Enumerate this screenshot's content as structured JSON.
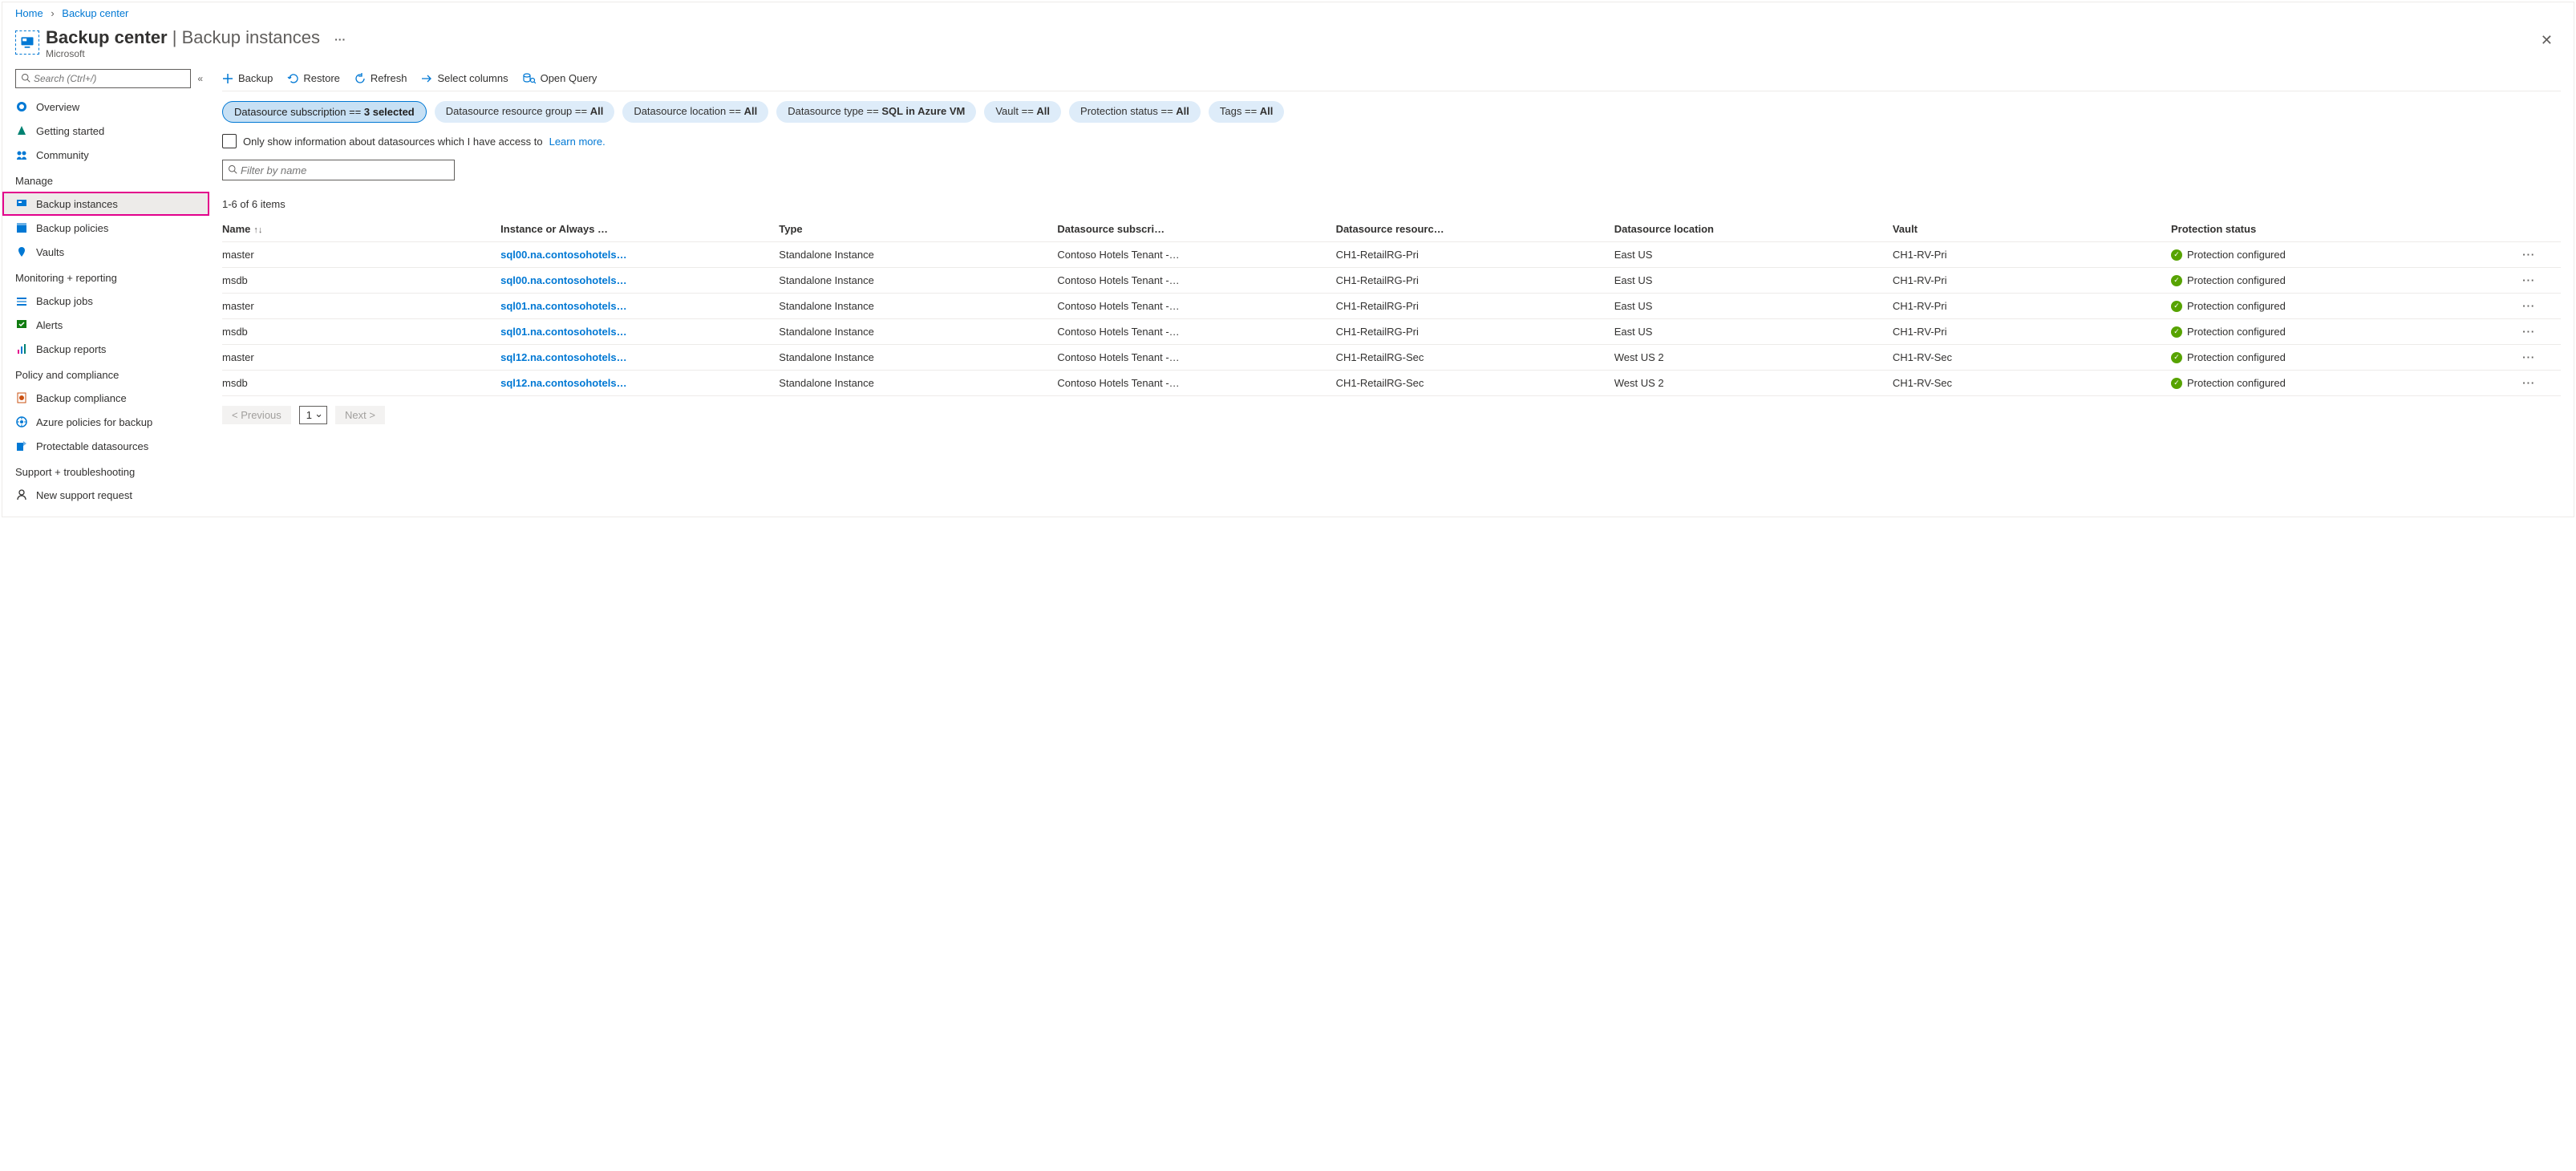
{
  "breadcrumb": {
    "home": "Home",
    "current": "Backup center"
  },
  "header": {
    "title_strong": "Backup center",
    "title_rest": "Backup instances",
    "subtitle": "Microsoft",
    "more": "···"
  },
  "sidebar": {
    "search_placeholder": "Search (Ctrl+/)",
    "top_items": [
      {
        "label": "Overview"
      },
      {
        "label": "Getting started"
      },
      {
        "label": "Community"
      }
    ],
    "groups": [
      {
        "label": "Manage",
        "items": [
          {
            "label": "Backup instances",
            "active": true
          },
          {
            "label": "Backup policies"
          },
          {
            "label": "Vaults"
          }
        ]
      },
      {
        "label": "Monitoring + reporting",
        "items": [
          {
            "label": "Backup jobs"
          },
          {
            "label": "Alerts"
          },
          {
            "label": "Backup reports"
          }
        ]
      },
      {
        "label": "Policy and compliance",
        "items": [
          {
            "label": "Backup compliance"
          },
          {
            "label": "Azure policies for backup"
          },
          {
            "label": "Protectable datasources"
          }
        ]
      },
      {
        "label": "Support + troubleshooting",
        "items": [
          {
            "label": "New support request"
          }
        ]
      }
    ]
  },
  "toolbar": {
    "backup": "Backup",
    "restore": "Restore",
    "refresh": "Refresh",
    "select_columns": "Select columns",
    "open_query": "Open Query"
  },
  "filters": [
    {
      "label": "Datasource subscription == ",
      "value": "3 selected",
      "selected": true
    },
    {
      "label": "Datasource resource group == ",
      "value": "All"
    },
    {
      "label": "Datasource location == ",
      "value": "All"
    },
    {
      "label": "Datasource type == ",
      "value": "SQL in Azure VM"
    },
    {
      "label": "Vault == ",
      "value": "All"
    },
    {
      "label": "Protection status == ",
      "value": "All"
    },
    {
      "label": "Tags == ",
      "value": "All"
    }
  ],
  "access_checkbox": {
    "text": "Only show information about datasources which I have access to ",
    "link": "Learn more."
  },
  "filter_input_placeholder": "Filter by name",
  "count_label": "1-6 of 6 items",
  "columns": [
    "Name",
    "Instance or Always …",
    "Type",
    "Datasource subscri…",
    "Datasource resourc…",
    "Datasource location",
    "Vault",
    "Protection status"
  ],
  "rows": [
    {
      "name": "master",
      "instance": "sql00.na.contosohotels…",
      "type": "Standalone Instance",
      "sub": "Contoso Hotels Tenant -…",
      "rg": "CH1-RetailRG-Pri",
      "loc": "East US",
      "vault": "CH1-RV-Pri",
      "status": "Protection configured"
    },
    {
      "name": "msdb",
      "instance": "sql00.na.contosohotels…",
      "type": "Standalone Instance",
      "sub": "Contoso Hotels Tenant -…",
      "rg": "CH1-RetailRG-Pri",
      "loc": "East US",
      "vault": "CH1-RV-Pri",
      "status": "Protection configured"
    },
    {
      "name": "master",
      "instance": "sql01.na.contosohotels…",
      "type": "Standalone Instance",
      "sub": "Contoso Hotels Tenant -…",
      "rg": "CH1-RetailRG-Pri",
      "loc": "East US",
      "vault": "CH1-RV-Pri",
      "status": "Protection configured"
    },
    {
      "name": "msdb",
      "instance": "sql01.na.contosohotels…",
      "type": "Standalone Instance",
      "sub": "Contoso Hotels Tenant -…",
      "rg": "CH1-RetailRG-Pri",
      "loc": "East US",
      "vault": "CH1-RV-Pri",
      "status": "Protection configured"
    },
    {
      "name": "master",
      "instance": "sql12.na.contosohotels…",
      "type": "Standalone Instance",
      "sub": "Contoso Hotels Tenant -…",
      "rg": "CH1-RetailRG-Sec",
      "loc": "West US 2",
      "vault": "CH1-RV-Sec",
      "status": "Protection configured"
    },
    {
      "name": "msdb",
      "instance": "sql12.na.contosohotels…",
      "type": "Standalone Instance",
      "sub": "Contoso Hotels Tenant -…",
      "rg": "CH1-RetailRG-Sec",
      "loc": "West US 2",
      "vault": "CH1-RV-Sec",
      "status": "Protection configured"
    }
  ],
  "pager": {
    "prev": "<  Previous",
    "page": "1",
    "next": "Next  >"
  }
}
